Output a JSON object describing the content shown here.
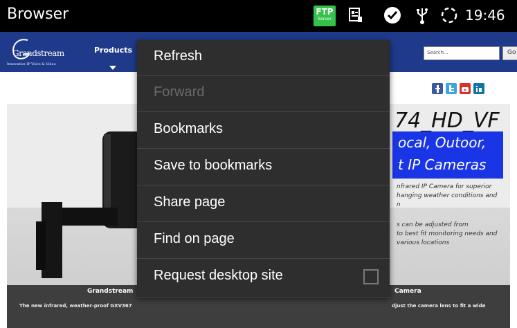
{
  "statusbar": {
    "app_title": "Browser",
    "ftp_label": "FTP",
    "ftp_sublabel": "Server",
    "ftp_color": "#33c24a",
    "icons": [
      "ftp-server-icon",
      "contacts-card-icon",
      "notification-check-icon",
      "usb-icon",
      "sync-spinner-icon"
    ],
    "time": "19:46"
  },
  "webpage": {
    "logo_word": "Grandstream",
    "logo_tagline": "Innovative IP Voice & Video",
    "nav_products": "Products",
    "search_placeholder": "Search...",
    "go_button": "Go",
    "nav_color": "#1f3a8a",
    "social_icons": [
      "facebook-icon",
      "twitter-icon",
      "youtube-icon",
      "linkedin-icon"
    ],
    "banner": {
      "headline": "74_HD_VF",
      "blue_lines": [
        "ocal, Outoor,",
        "t IP Cameras"
      ],
      "blue_color": "#1a35e6",
      "description_lines": [
        "nfrared IP Camera for superior",
        "hanging weather conditions and",
        "n",
        "s can be adjusted from",
        "to best fit monitoring needs and",
        "various locations"
      ],
      "caption_left_title": "Grandstream",
      "caption_right_title": "Camera",
      "caption_left_text": "The new infrared, weather-proof GXV367",
      "caption_right_text": "djust the camera lens to fit a wide"
    }
  },
  "menu": {
    "items": [
      {
        "label": "Refresh",
        "enabled": true
      },
      {
        "label": "Forward",
        "enabled": false
      },
      {
        "label": "Bookmarks",
        "enabled": true
      },
      {
        "label": "Save to bookmarks",
        "enabled": true
      },
      {
        "label": "Share page",
        "enabled": true
      },
      {
        "label": "Find on page",
        "enabled": true
      },
      {
        "label": "Request desktop site",
        "enabled": true,
        "checkbox": false
      }
    ]
  }
}
